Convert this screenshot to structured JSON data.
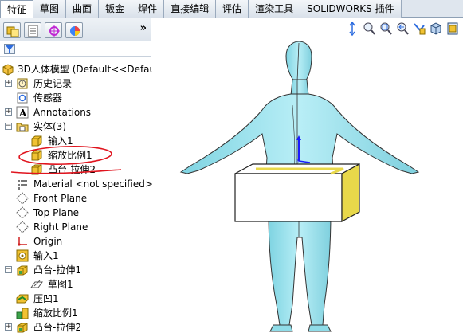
{
  "tabs": [
    {
      "label": "特征",
      "active": true
    },
    {
      "label": "草图"
    },
    {
      "label": "曲面"
    },
    {
      "label": "钣金"
    },
    {
      "label": "焊件"
    },
    {
      "label": "直接编辑"
    },
    {
      "label": "评估"
    },
    {
      "label": "渲染工具"
    },
    {
      "label": "SOLIDWORKS 插件"
    }
  ],
  "panel": {
    "more_label": "»",
    "tree": [
      {
        "label": "3D人体模型  (Default<<Defau",
        "icon": "part-icon"
      },
      {
        "label": "历史记录",
        "icon": "history-icon"
      },
      {
        "label": "传感器",
        "icon": "sensor-icon"
      },
      {
        "label": "Annotations",
        "icon": "annotations-icon"
      },
      {
        "label": "实体(3)",
        "icon": "solid-bodies-folder-icon"
      },
      {
        "label": "输入1",
        "icon": "body-icon"
      },
      {
        "label": "缩放比例1",
        "icon": "body-icon"
      },
      {
        "label": "凸台-拉伸2",
        "icon": "body-icon"
      },
      {
        "label": "Material <not specified>",
        "icon": "material-icon"
      },
      {
        "label": "Front Plane",
        "icon": "plane-icon"
      },
      {
        "label": "Top Plane",
        "icon": "plane-icon"
      },
      {
        "label": "Right Plane",
        "icon": "plane-icon"
      },
      {
        "label": "Origin",
        "icon": "origin-icon"
      },
      {
        "label": "输入1",
        "icon": "import-feature-icon"
      },
      {
        "label": "凸台-拉伸1",
        "icon": "extrude-icon"
      },
      {
        "label": "草图1",
        "icon": "sketch-icon"
      },
      {
        "label": "压凹1",
        "icon": "indent-icon"
      },
      {
        "label": "缩放比例1",
        "icon": "scale-icon"
      },
      {
        "label": "凸台-拉伸2",
        "icon": "extrude-icon"
      }
    ]
  },
  "colors": {
    "tab_bg": "#dfe6ee",
    "model_body": "#9fe3ee",
    "box_face": "#ffffff",
    "box_selected_face": "#e8d84a",
    "annotation_red": "#e0141e",
    "triad_blue": "#1a1aff"
  }
}
